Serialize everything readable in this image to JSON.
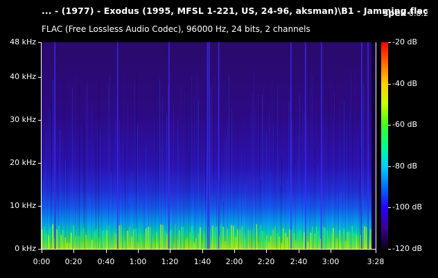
{
  "window": {
    "title": "... - (1977) - Exodus (1995, MFSL 1-221, US, 24-96, aksman)\\B1 - Jamming.flac",
    "app_name": "spek",
    "app_version": "0.8.2",
    "info": "FLAC (Free Lossless Audio Codec), 96000 Hz, 24 bits, 2 channels"
  },
  "spectrogram": {
    "freq_labels": [
      "48 kHz",
      "40 kHz",
      "30 kHz",
      "20 kHz",
      "10 kHz",
      "0 kHz"
    ],
    "freq_values_khz": [
      48,
      40,
      30,
      20,
      10,
      0
    ],
    "time_labels": [
      "0:00",
      "0:20",
      "0:40",
      "1:00",
      "1:20",
      "1:40",
      "2:00",
      "2:20",
      "2:40",
      "3:00",
      "3:28"
    ],
    "time_values_s": [
      0,
      20,
      40,
      60,
      80,
      100,
      120,
      140,
      160,
      180,
      208
    ],
    "duration_s": 208,
    "max_freq_khz": 48,
    "db_labels": [
      "-20 dB",
      "-40 dB",
      "-60 dB",
      "-80 dB",
      "-100 dB",
      "-120 dB"
    ],
    "db_values": [
      -20,
      -40,
      -60,
      -80,
      -100,
      -120
    ],
    "transient_times_s": [
      8,
      47,
      79,
      103,
      104,
      110,
      155,
      164,
      174,
      199,
      203
    ]
  }
}
